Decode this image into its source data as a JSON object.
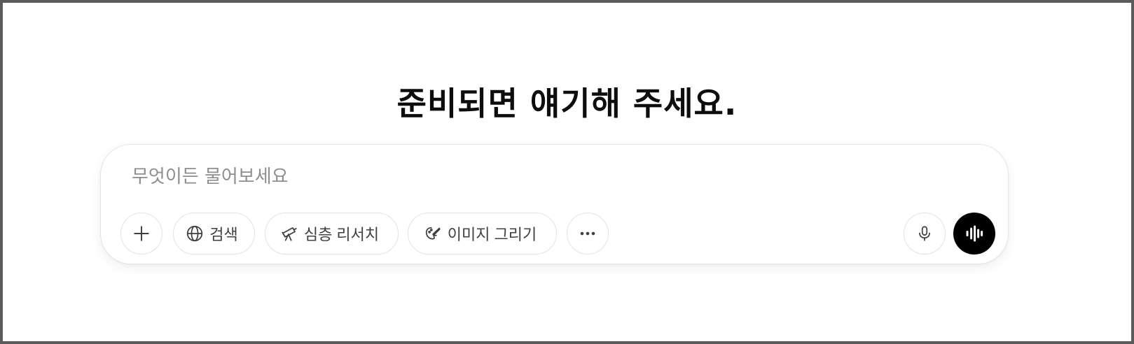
{
  "headline": "준비되면 얘기해 주세요.",
  "composer": {
    "placeholder": "무엇이든 물어보세요",
    "value": ""
  },
  "toolbar": {
    "add": {
      "icon": "plus-icon"
    },
    "search": {
      "label": "검색",
      "icon": "globe-icon"
    },
    "deep_research": {
      "label": "심층 리서치",
      "icon": "telescope-icon"
    },
    "image": {
      "label": "이미지 그리기",
      "icon": "paintbrush-icon"
    },
    "more": {
      "icon": "more-horizontal-icon"
    },
    "mic": {
      "icon": "microphone-icon"
    },
    "voice": {
      "icon": "voice-wave-icon"
    }
  },
  "colors": {
    "background": "#ffffff",
    "frame_border": "#5b5b5b",
    "text": "#0d0d0d",
    "placeholder": "#8e8e8e",
    "button_border": "#e3e3e3",
    "voice_button": "#000000"
  }
}
